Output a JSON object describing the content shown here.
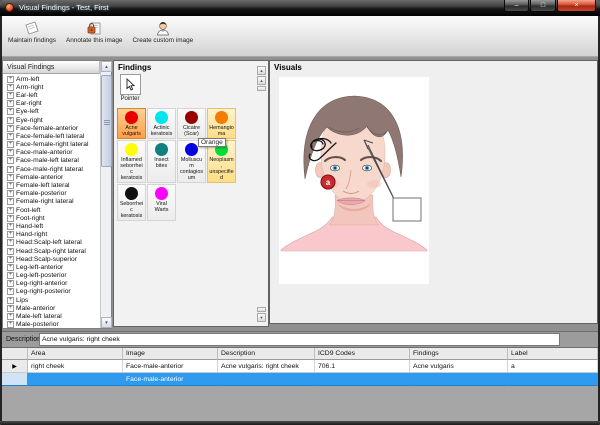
{
  "window": {
    "title": "Visual Findings - Test, First"
  },
  "icons": {
    "plus": "+",
    "up_arrow": "▲",
    "down_arrow": "▼",
    "row_selector": "▶",
    "minimize": "–",
    "maximize": "□",
    "close": "×"
  },
  "toolbar": {
    "buttons": [
      {
        "label": "Maintain findings"
      },
      {
        "label": "Annotate this image"
      },
      {
        "label": "Create custom image"
      }
    ]
  },
  "tree": {
    "header": "Visual Findings",
    "items": [
      "Arm-left",
      "Arm-right",
      "Ear-left",
      "Ear-right",
      "Eye-left",
      "Eye-right",
      "Face-female-anterior",
      "Face-female-left lateral",
      "Face-female-right lateral",
      "Face-male-anterior",
      "Face-male-left lateral",
      "Face-male-right lateral",
      "Female-anterior",
      "Female-left lateral",
      "Female-posterior",
      "Female-right lateral",
      "Foot-left",
      "Foot-right",
      "Hand-left",
      "Hand-right",
      "Head:Scalp-left lateral",
      "Head:Scalp-right lateral",
      "Head:Scalp-superior",
      "Leg-left-anterior",
      "Leg-left-posterior",
      "Leg-right-anterior",
      "Leg-right-posterior",
      "Lips",
      "Male-anterior",
      "Male-left lateral",
      "Male-posterior"
    ]
  },
  "findings_panel": {
    "title": "Findings",
    "pointer_label": "Pointer",
    "tooltip": "Orange",
    "swatches": [
      {
        "label": "Acne vulgaris",
        "color": "#e60000",
        "selected": true
      },
      {
        "label": "Actinic keratosis",
        "color": "#00e4ee"
      },
      {
        "label": "Cicatre (Scar)",
        "color": "#9a0000"
      },
      {
        "label": "Hemangioma",
        "color": "#f47c00",
        "highlighted": true
      },
      {
        "label": "Inflamed seborrheic keratosis",
        "color": "#ffff00"
      },
      {
        "label": "Insect bites",
        "color": "#0e8080"
      },
      {
        "label": "Molluscum contagiosum",
        "color": "#0000e0"
      },
      {
        "label": "Neoplasm, unspecified",
        "color": "#00dd3a",
        "highlighted": true
      },
      {
        "label": "Seborrheic keratosis",
        "color": "#101010"
      },
      {
        "label": "Viral Warts",
        "color": "#ff00ff"
      }
    ]
  },
  "visuals_panel": {
    "title": "Visuals",
    "annotation_label": "a"
  },
  "description": {
    "label": "Description:",
    "value": "Acne vulgaris: right cheek"
  },
  "table": {
    "columns": [
      "Area",
      "Image",
      "Description",
      "ICD9 Codes",
      "Findings",
      "Label"
    ],
    "rows": [
      {
        "area": "right cheek",
        "image": "Face-male-anterior",
        "description": "Acne vulgaris: right cheek",
        "icd9": "706.1",
        "findings": "Acne vulgaris",
        "label": "a"
      },
      {
        "area": "",
        "image": "Face-male-anterior",
        "description": "",
        "icd9": "",
        "findings": "",
        "label": ""
      }
    ]
  }
}
